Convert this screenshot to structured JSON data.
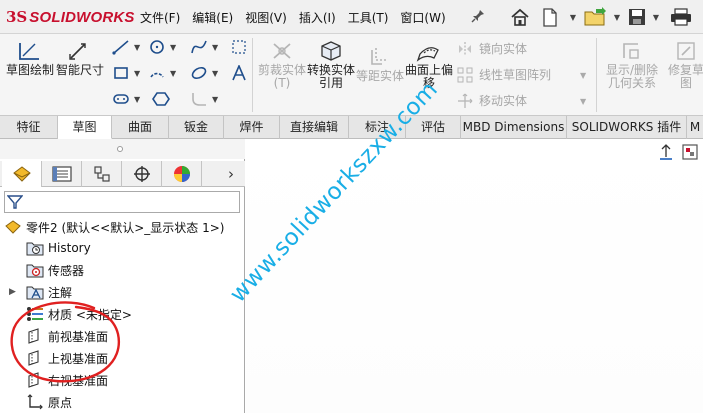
{
  "app": {
    "logo_prefix": "3S",
    "logo_text": "SOLIDWORKS"
  },
  "menu": [
    "文件(F)",
    "编辑(E)",
    "视图(V)",
    "插入(I)",
    "工具(T)",
    "窗口(W)"
  ],
  "quick_access": [
    "home-icon",
    "new-document-icon",
    "open-icon",
    "save-icon",
    "print-icon"
  ],
  "ribbon": {
    "sketch": "草图绘制",
    "smart_dimension": "智能尺寸",
    "trim": "剪裁实体(T)",
    "convert": "转换实体引用",
    "offset": "等距实体",
    "offset_on_surface": "曲面上偏移",
    "mirror": "镜向实体",
    "linear_pattern": "线性草图阵列",
    "move": "移动实体",
    "show_delete_relations": "显示/删除几何关系",
    "repair": "修复草图"
  },
  "tabs": [
    "特征",
    "草图",
    "曲面",
    "钣金",
    "焊件",
    "直接编辑",
    "标注",
    "评估",
    "MBD Dimensions",
    "SOLIDWORKS 插件",
    "M"
  ],
  "active_tab": "草图",
  "panel_tabs": [
    "feature-manager-icon",
    "property-manager-icon",
    "configuration-manager-icon",
    "dimxpert-icon",
    "display-manager-icon"
  ],
  "tree": {
    "part": "零件2 (默认<<默认>_显示状态 1>)",
    "items": [
      {
        "label": "History",
        "icon": "history-folder-icon"
      },
      {
        "label": "传感器",
        "icon": "sensor-icon"
      },
      {
        "label": "注解",
        "icon": "annotation-icon"
      },
      {
        "label": "材质 <未指定>",
        "icon": "material-icon"
      },
      {
        "label": "前视基准面",
        "icon": "plane-icon"
      },
      {
        "label": "上视基准面",
        "icon": "plane-icon"
      },
      {
        "label": "右视基准面",
        "icon": "plane-icon"
      },
      {
        "label": "原点",
        "icon": "origin-icon"
      }
    ]
  },
  "watermark": "www.solidworkszxw.com",
  "colors": {
    "brand": "#c8102e",
    "watermark": "#19aee6",
    "annotation_circle": "#e02020"
  }
}
